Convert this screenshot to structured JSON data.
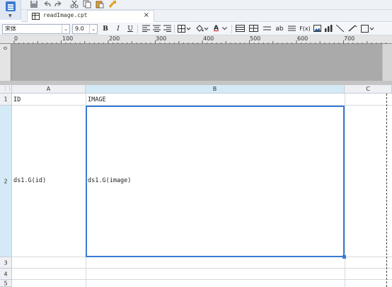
{
  "tab": {
    "label": "readImage.cpt"
  },
  "font": {
    "name": "宋体",
    "size": "9.0"
  },
  "toolbar": {
    "bold": "B",
    "italic": "I",
    "underline": "U",
    "text_color_letter": "A",
    "wrap_label": "ab",
    "formula_label": "F(x)"
  },
  "ruler": {
    "zero": "0",
    "ticks": [
      "0",
      "100",
      "200",
      "300",
      "400",
      "500",
      "600",
      "700"
    ]
  },
  "grid": {
    "corner": "⋮⋮⋮",
    "columns": [
      "A",
      "B",
      "C"
    ],
    "rows": [
      "1",
      "2",
      "3",
      "4",
      "5"
    ],
    "cells": {
      "A1": "ID",
      "B1": "IMAGE",
      "A2": "ds1.G(id)",
      "B2": "ds1.G(image)"
    },
    "selected_column": "B",
    "selected_row": "2"
  },
  "colors": {
    "accent": "#3a7bd5",
    "header_bg": "#eef0f3",
    "selected_header_bg": "#d4eaf7",
    "ruler_canvas": "#aaaaaa"
  }
}
